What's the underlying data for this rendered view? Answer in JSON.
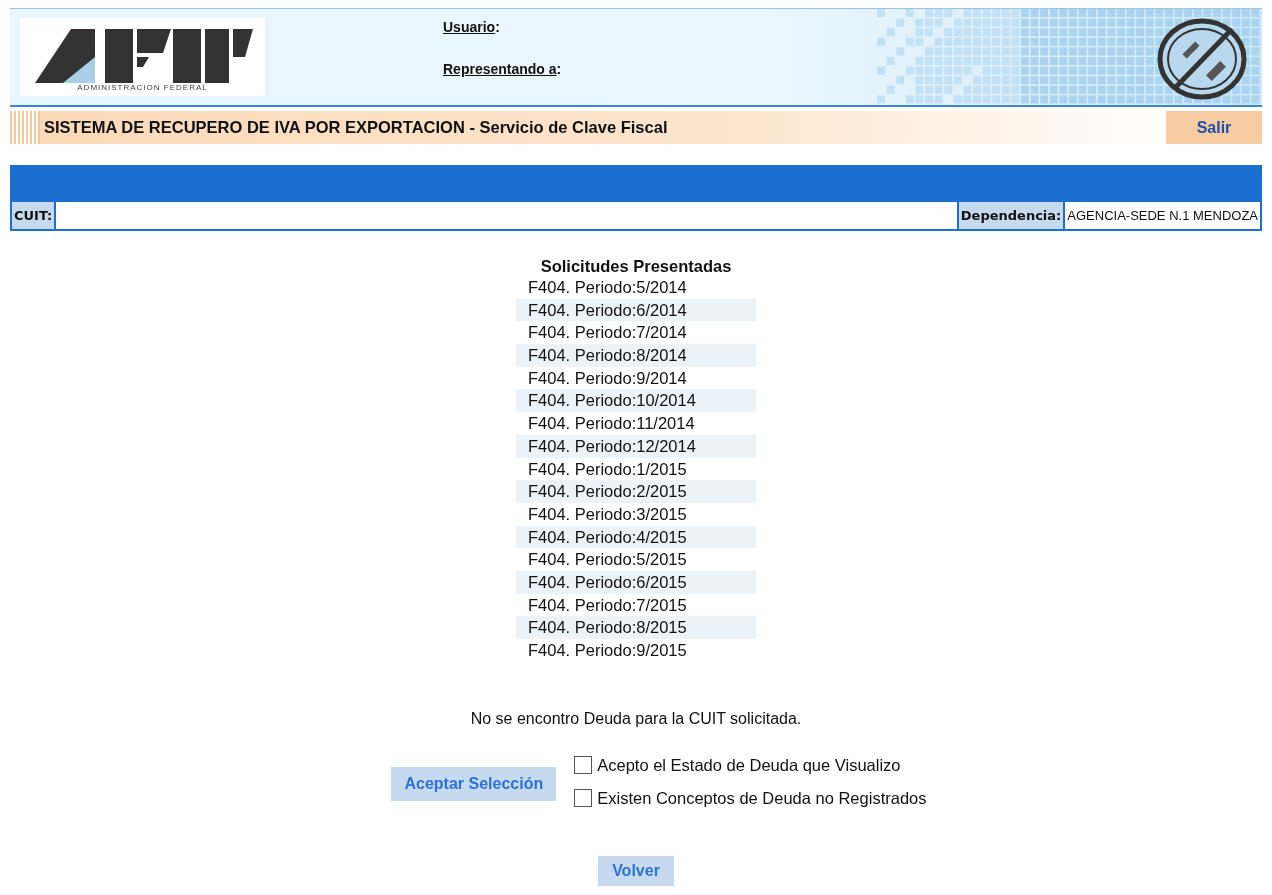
{
  "header": {
    "logo_caption": "ADMINISTRACION FEDERAL",
    "user_label": "Usuario",
    "represent_label": "Representando a",
    "label_separator": ":"
  },
  "title_bar": {
    "title": "SISTEMA DE RECUPERO DE IVA POR EXPORTACION - Servicio de Clave Fiscal",
    "exit": "Salir"
  },
  "info_row": {
    "cuit_label": "CUIT:",
    "dependencia_label": "Dependencia:",
    "dependencia_value": "AGENCIA-SEDE N.1 MENDOZA"
  },
  "requests": {
    "title": "Solicitudes Presentadas",
    "items": [
      "F404. Periodo:5/2014",
      "F404. Periodo:6/2014",
      "F404. Periodo:7/2014",
      "F404. Periodo:8/2014",
      "F404. Periodo:9/2014",
      "F404. Periodo:10/2014",
      "F404. Periodo:11/2014",
      "F404. Periodo:12/2014",
      "F404. Periodo:1/2015",
      "F404. Periodo:2/2015",
      "F404. Periodo:3/2015",
      "F404. Periodo:4/2015",
      "F404. Periodo:5/2015",
      "F404. Periodo:6/2015",
      "F404. Periodo:7/2015",
      "F404. Periodo:8/2015",
      "F404. Periodo:9/2015"
    ]
  },
  "message": "No se encontro Deuda para la CUIT solicitada.",
  "accept_button": "Aceptar Selección",
  "options": [
    {
      "label": "Acepto el Estado de Deuda que Visualizo",
      "checked": false
    },
    {
      "label": "Existen Conceptos de Deuda no Registrados",
      "checked": false
    }
  ],
  "back_button": "Volver"
}
